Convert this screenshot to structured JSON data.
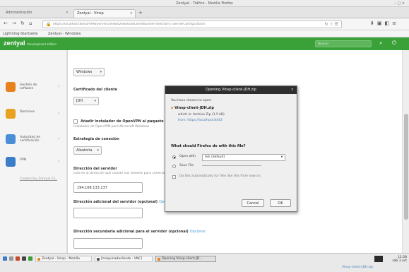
{
  "window": {
    "title": "Zentyal - Tráfico - Mozilla Firefox",
    "controls": "– □ ×"
  },
  "tabs": [
    {
      "label": "Administración",
      "active": false
    },
    {
      "label": "Zentyal - Vinsp",
      "active": true
    }
  ],
  "url": "https://localhost:8443/VPN/Servers/View/DownloadClientBundle?directory=ServerConfiguration",
  "url_right": "↻ ☆ ☰",
  "bookmarks": [
    {
      "label": "Lightning-Startseite"
    },
    {
      "label": "Zentyal - Windows"
    }
  ],
  "header": {
    "logo": "zentyal",
    "sublogo": "Development Edition",
    "search_placeholder": "Buscar",
    "search_icon": "🔍"
  },
  "sidebar": {
    "items": [
      {
        "label": "Gestión de software",
        "icon": "package-icon",
        "color": "#e8821e"
      },
      {
        "label": "Dominios",
        "icon": "domain-icon",
        "color": "#e8a21e"
      },
      {
        "label": "Autoridad de certificación",
        "icon": "certificate-icon",
        "color": "#4a8ed8"
      },
      {
        "label": "VPN",
        "icon": "vpn-icon",
        "color": "#3a7ec8"
      }
    ],
    "footer": "Created by Zentyal S.L."
  },
  "form": {
    "top_select": "Windows",
    "cert_label": "Certificado del cliente",
    "cert_value": "JDH",
    "add_openvpn_label": "Añadir instalador de OpenVPN al paquete",
    "add_openvpn_hint": "Instalador de OpenVPN para Microsoft Windows",
    "strategy_label": "Estrategia de conexión",
    "strategy_value": "Aleatoria",
    "server_addr_label": "Dirección del servidor",
    "server_addr_hint": "Esta es la dirección que usarán sus clientes para conectar con el servidor. Normalmente, ésta será una dirección IP pública",
    "server_addr_value": "194.168.133.237",
    "additional_addr_label": "Dirección adicional del servidor (opcional)",
    "additional_addr_opt": "Opcional",
    "secondary_addr_label": "Dirección secundaria adicional para el servidor (opcional)",
    "secondary_addr_opt": "Opcional"
  },
  "dialog": {
    "title": "Opening Vinsp-client-JDH.zip",
    "intro": "You have chosen to open:",
    "filename": "Vinsp-client-JDH.zip",
    "which_is": "which is: Archivo Zip (1.5 kB)",
    "from": "from: https://localhost:8443",
    "question": "What should Firefox do with this file?",
    "open_with_label": "Open with",
    "open_with_value": "Ark (default)",
    "save_file_label": "Save File",
    "auto_label": "Do this automatically for files like this from now on.",
    "cancel": "Cancel",
    "ok": "OK"
  },
  "taskbar": {
    "items": [
      {
        "label": "Zentyal - Vinsp - Mozilla",
        "active": false
      },
      {
        "label": "[maquinadecliente - VNC]",
        "active": false
      },
      {
        "label": "Opening Vinsp-client-JD...",
        "active": true
      }
    ],
    "clock": "11:58",
    "date": "sáb 3 oct",
    "status_line": "Vinsp-client-JDH.zip"
  }
}
